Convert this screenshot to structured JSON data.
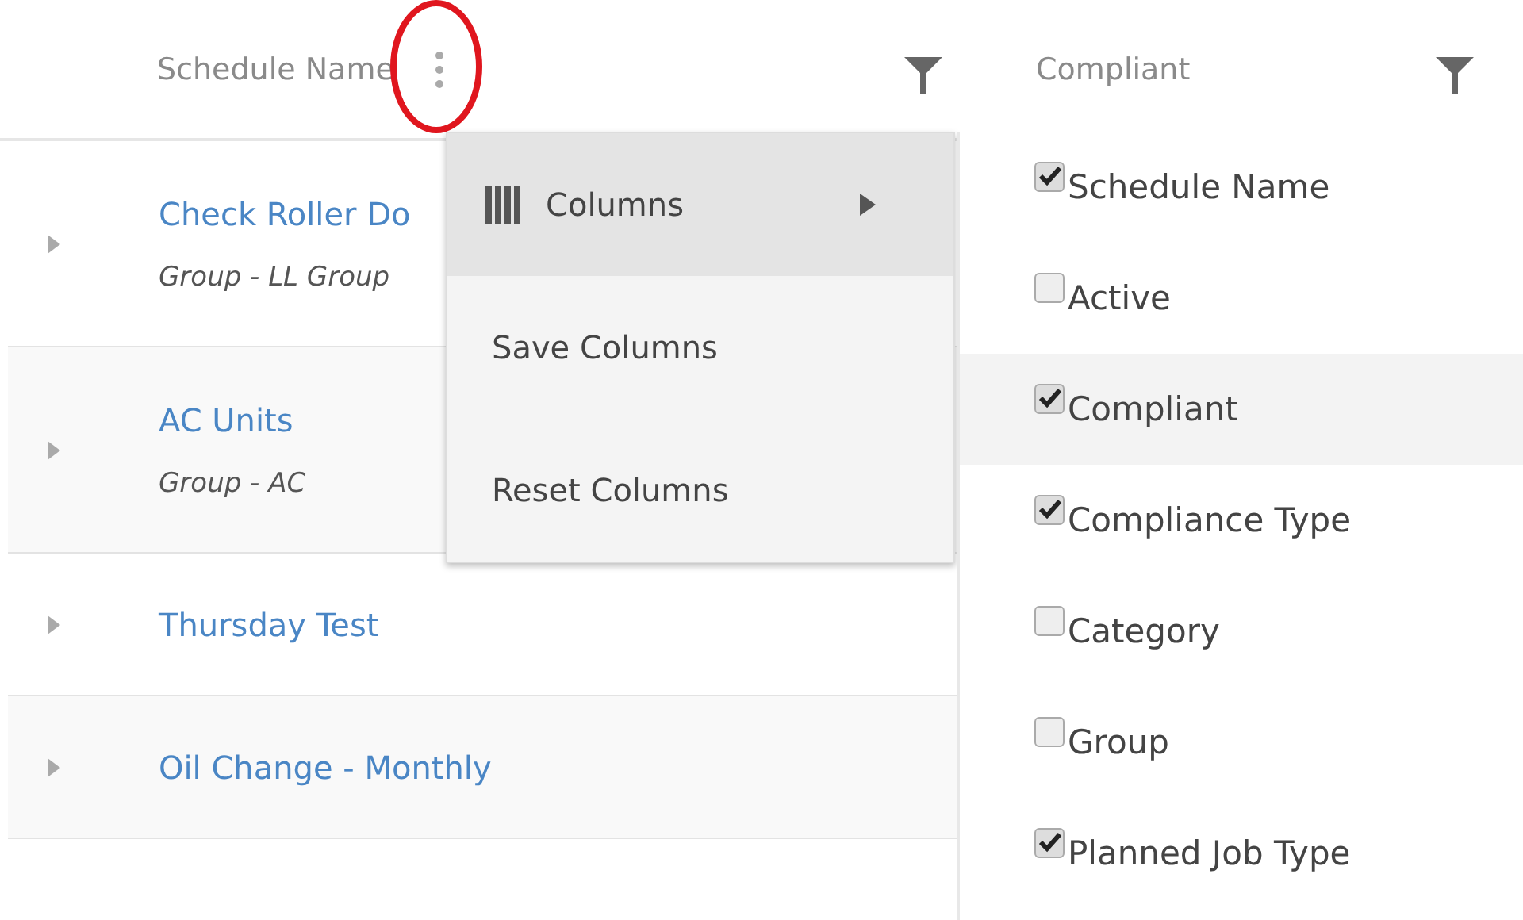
{
  "table": {
    "columns": [
      {
        "label": "Schedule Name",
        "menu_button": true
      },
      {
        "label": "Compliant",
        "menu_button": false
      }
    ],
    "rows": [
      {
        "name": "Check Roller Do",
        "group": "Group - LL Group"
      },
      {
        "name": "AC Units",
        "group": "Group - AC"
      },
      {
        "name": "Thursday Test"
      },
      {
        "name": "Oil Change - Monthly"
      }
    ]
  },
  "context_menu": {
    "items": [
      {
        "label": "Columns",
        "kind": "submenu",
        "selected": true
      },
      {
        "label": "Save Columns",
        "kind": "action",
        "selected": false
      },
      {
        "label": "Reset Columns",
        "kind": "action",
        "selected": false
      }
    ]
  },
  "column_chooser": {
    "items": [
      {
        "label": "Schedule Name",
        "checked": true,
        "selected": false
      },
      {
        "label": "Active",
        "checked": false,
        "selected": false
      },
      {
        "label": "Compliant",
        "checked": true,
        "selected": true
      },
      {
        "label": "Compliance Type",
        "checked": true,
        "selected": false
      },
      {
        "label": "Category",
        "checked": false,
        "selected": false
      },
      {
        "label": "Group",
        "checked": false,
        "selected": false
      },
      {
        "label": "Planned Job Type",
        "checked": true,
        "selected": false
      }
    ]
  },
  "annotation": {
    "kind": "ellipse"
  }
}
